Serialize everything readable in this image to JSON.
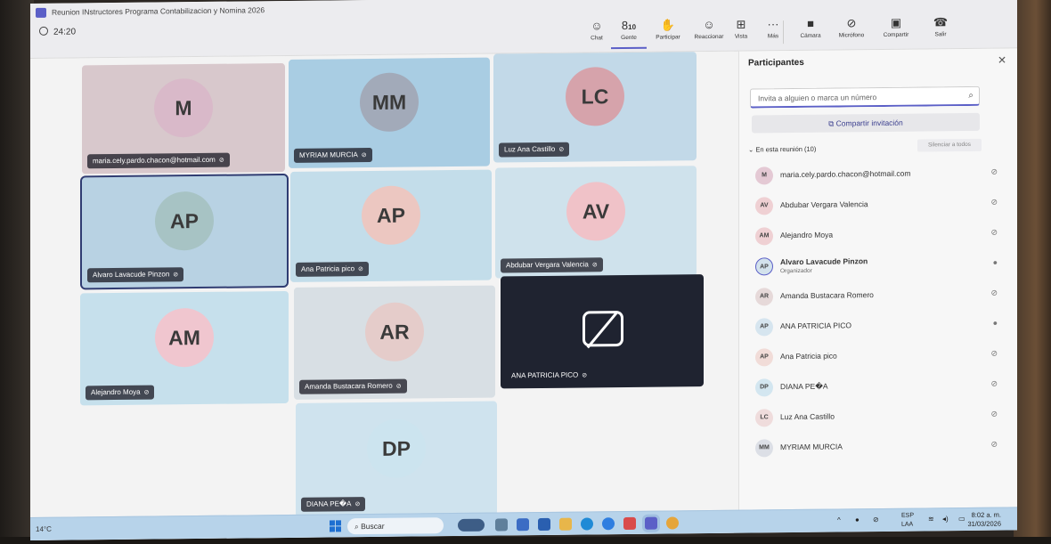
{
  "window": {
    "title": "Reunion INstructores Programa Contabilizacion y Nomina 2026"
  },
  "timer": "24:20",
  "toolbar": [
    {
      "label": "Chat",
      "icon": "chat-icon",
      "glyph": "☺"
    },
    {
      "label": "Gente",
      "icon": "people-icon",
      "glyph": "8",
      "badge": "10",
      "active": true
    },
    {
      "label": "Participar",
      "icon": "raise-hand-icon",
      "glyph": "✋"
    },
    {
      "label": "Reaccionar",
      "icon": "react-icon",
      "glyph": "☺"
    },
    {
      "label": "Vista",
      "icon": "view-icon",
      "glyph": "⊞"
    },
    {
      "label": "Más",
      "icon": "more-icon",
      "glyph": "···"
    },
    {
      "label": "Cámara",
      "icon": "camera-off-icon",
      "glyph": "■"
    },
    {
      "label": "Micrófono",
      "icon": "mic-off-icon",
      "glyph": "⊘"
    },
    {
      "label": "Compartir",
      "icon": "share-icon",
      "glyph": "▣"
    },
    {
      "label": "Salir",
      "icon": "leave-icon",
      "glyph": "☎"
    }
  ],
  "tiles": [
    {
      "initials": "M",
      "name": "maria.cely.pardo.chacon@hotmail.com",
      "bg": "#d8c8cc",
      "avatar": "#d9b9c9"
    },
    {
      "initials": "MM",
      "name": "MYRIAM MURCIA",
      "bg": "#a9cde3",
      "avatar": "#a2aab9"
    },
    {
      "initials": "LC",
      "name": "Luz Ana Castillo",
      "bg": "#c2d9e8",
      "avatar": "#d6a3ab"
    },
    {
      "initials": "AP",
      "name": "Alvaro Lavacude Pinzon",
      "bg": "#b8d2e3",
      "avatar": "#a7c3c4"
    },
    {
      "initials": "AP",
      "name": "Ana Patricia pico",
      "bg": "#c3ddea",
      "avatar": "#ecc7c1"
    },
    {
      "initials": "AV",
      "name": "Abdubar Vergara Valencia",
      "bg": "#cfe2ec",
      "avatar": "#f0c2c8"
    },
    {
      "initials": "AM",
      "name": "Alejandro Moya",
      "bg": "#c6e0ec",
      "avatar": "#f0c6cf"
    },
    {
      "initials": "AR",
      "name": "Amanda Bustacara Romero",
      "bg": "#d8dfe4",
      "avatar": "#e5ccca"
    },
    {
      "initials": "",
      "name": "ANA PATRICIA PICO",
      "bg": "#1f2330",
      "avatar": ""
    },
    {
      "initials": "DP",
      "name": "DIANA PE�A",
      "bg": "#cfe3ee",
      "avatar": "#cce4ef"
    }
  ],
  "panel": {
    "title": "Participantes",
    "search_placeholder": "Invita a alguien o marca un número",
    "share_label": "Compartir invitación",
    "section_label": "En esta reunión (10)",
    "mute_all": "Silenciar a todos",
    "participants": [
      {
        "initials": "M",
        "name": "maria.cely.pardo.chacon@hotmail.com",
        "color": "#e4c9d4"
      },
      {
        "initials": "AV",
        "name": "Abdubar Vergara Valencia",
        "color": "#efd0d3"
      },
      {
        "initials": "AM",
        "name": "Alejandro Moya",
        "color": "#efd0d3"
      },
      {
        "initials": "AP",
        "name": "Alvaro Lavacude Pinzon",
        "role": "Organizador",
        "color": "#d3e2ec",
        "organizer": true
      },
      {
        "initials": "AR",
        "name": "Amanda Bustacara Romero",
        "color": "#e6d9d9"
      },
      {
        "initials": "AP",
        "name": "ANA PATRICIA PICO",
        "color": "#d6e5ef"
      },
      {
        "initials": "AP",
        "name": "Ana Patricia pico",
        "color": "#f1dcd8"
      },
      {
        "initials": "DP",
        "name": "DIANA PE�A",
        "color": "#d3e6f0"
      },
      {
        "initials": "LC",
        "name": "Luz Ana Castillo",
        "color": "#efdcdc"
      },
      {
        "initials": "MM",
        "name": "MYRIAM MURCIA",
        "color": "#dcdfe6"
      }
    ]
  },
  "taskbar": {
    "weather": "14°C",
    "search": "Buscar",
    "lang_top": "ESP",
    "lang_bottom": "LAA",
    "time": "8:02 a. m.",
    "date": "31/03/2026"
  },
  "accent": "#5b5fc7"
}
